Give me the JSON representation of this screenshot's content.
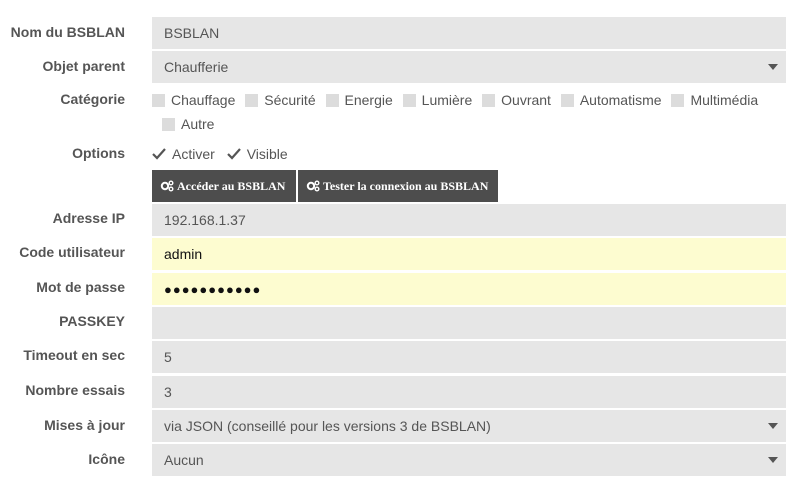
{
  "labels": {
    "name": "Nom du BSBLAN",
    "parent": "Objet parent",
    "category": "Catégorie",
    "options": "Options",
    "ip": "Adresse IP",
    "user": "Code utilisateur",
    "password": "Mot de passe",
    "passkey": "PASSKEY",
    "timeout": "Timeout en sec",
    "retries": "Nombre essais",
    "updates": "Mises à jour",
    "icon": "Icône"
  },
  "fields": {
    "name": "BSBLAN",
    "parent": "Chaufferie",
    "ip": "192.168.1.37",
    "user": "admin",
    "password": "●●●●●●●●●●●",
    "passkey": "",
    "timeout": "5",
    "retries": "3",
    "updates": "via JSON (conseillé pour les versions 3 de BSBLAN)",
    "icon": "Aucun"
  },
  "categories": [
    {
      "label": "Chauffage",
      "checked": false
    },
    {
      "label": "Sécurité",
      "checked": false
    },
    {
      "label": "Energie",
      "checked": false
    },
    {
      "label": "Lumière",
      "checked": false
    },
    {
      "label": "Ouvrant",
      "checked": false
    },
    {
      "label": "Automatisme",
      "checked": false
    },
    {
      "label": "Multimédia",
      "checked": false
    },
    {
      "label": "Autre",
      "checked": false
    }
  ],
  "options": [
    {
      "label": "Activer",
      "checked": true
    },
    {
      "label": "Visible",
      "checked": true
    }
  ],
  "buttons": {
    "access": "Accéder au BSBLAN",
    "test": "Tester la connexion au BSBLAN"
  },
  "icons": {
    "buttons": "cogs-icon",
    "select": "caret-down-icon",
    "checkbox_on": "check-icon"
  },
  "colors": {
    "field_bg": "#e6e6e6",
    "field_highlight": "#fdfcd0",
    "button_bg": "#4d4d4d"
  }
}
